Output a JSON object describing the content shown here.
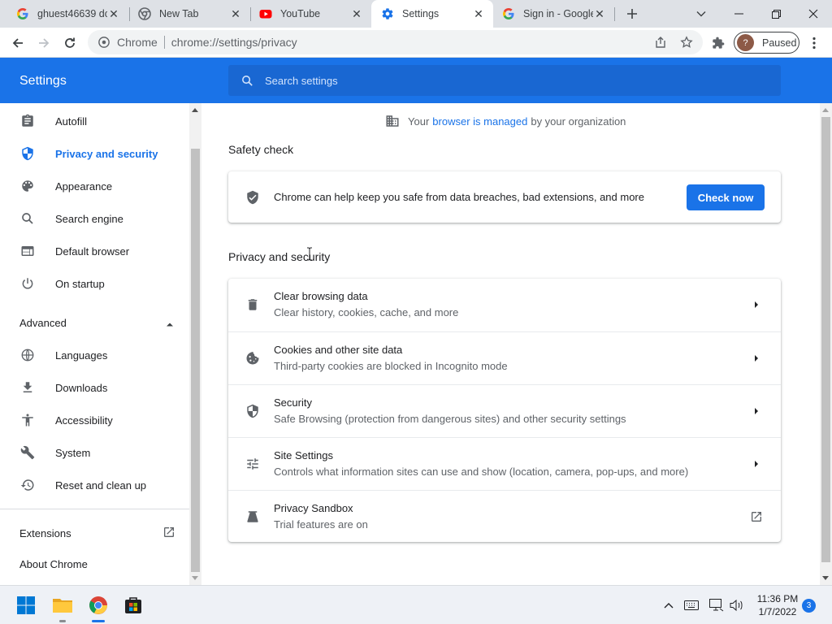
{
  "tabs": [
    {
      "title": "ghuest46639 dc",
      "icon": "google-g-icon"
    },
    {
      "title": "New Tab",
      "icon": "chrome-icon"
    },
    {
      "title": "YouTube",
      "icon": "youtube-icon"
    },
    {
      "title": "Settings",
      "icon": "settings-gear-icon",
      "active": true
    },
    {
      "title": "Sign in - Google",
      "icon": "google-g-icon"
    }
  ],
  "toolbar": {
    "origin_label": "Chrome",
    "url": "chrome://settings/privacy",
    "profile_initial": "?",
    "profile_status": "Paused"
  },
  "header": {
    "title": "Settings",
    "search_placeholder": "Search settings"
  },
  "sidebar": {
    "items": [
      {
        "label": "Autofill",
        "icon": "clipboard-icon"
      },
      {
        "label": "Privacy and security",
        "icon": "shield-icon",
        "active": true
      },
      {
        "label": "Appearance",
        "icon": "palette-icon"
      },
      {
        "label": "Search engine",
        "icon": "search-icon"
      },
      {
        "label": "Default browser",
        "icon": "browser-window-icon"
      },
      {
        "label": "On startup",
        "icon": "power-icon"
      }
    ],
    "advanced_label": "Advanced",
    "advanced_items": [
      {
        "label": "Languages",
        "icon": "globe-icon"
      },
      {
        "label": "Downloads",
        "icon": "download-icon"
      },
      {
        "label": "Accessibility",
        "icon": "accessibility-icon"
      },
      {
        "label": "System",
        "icon": "wrench-icon"
      },
      {
        "label": "Reset and clean up",
        "icon": "history-icon"
      }
    ],
    "extensions_label": "Extensions",
    "about_label": "About Chrome"
  },
  "main": {
    "managed_prefix": "Your",
    "managed_link": "browser is managed",
    "managed_suffix": "by your organization",
    "safety_check": {
      "title": "Safety check",
      "text": "Chrome can help keep you safe from data breaches, bad extensions, and more",
      "button": "Check now"
    },
    "privacy": {
      "title": "Privacy and security",
      "rows": [
        {
          "title": "Clear browsing data",
          "subtitle": "Clear history, cookies, cache, and more",
          "icon": "trash-icon"
        },
        {
          "title": "Cookies and other site data",
          "subtitle": "Third-party cookies are blocked in Incognito mode",
          "icon": "cookie-icon"
        },
        {
          "title": "Security",
          "subtitle": "Safe Browsing (protection from dangerous sites) and other security settings",
          "icon": "shield-icon"
        },
        {
          "title": "Site Settings",
          "subtitle": "Controls what information sites can use and show (location, camera, pop-ups, and more)",
          "icon": "sliders-icon"
        },
        {
          "title": "Privacy Sandbox",
          "subtitle": "Trial features are on",
          "icon": "flask-icon"
        }
      ]
    }
  },
  "taskbar": {
    "time": "11:36 PM",
    "date": "1/7/2022",
    "notifications": "3"
  },
  "colors": {
    "accent": "#1a73e8",
    "header_search": "#1967d2"
  }
}
